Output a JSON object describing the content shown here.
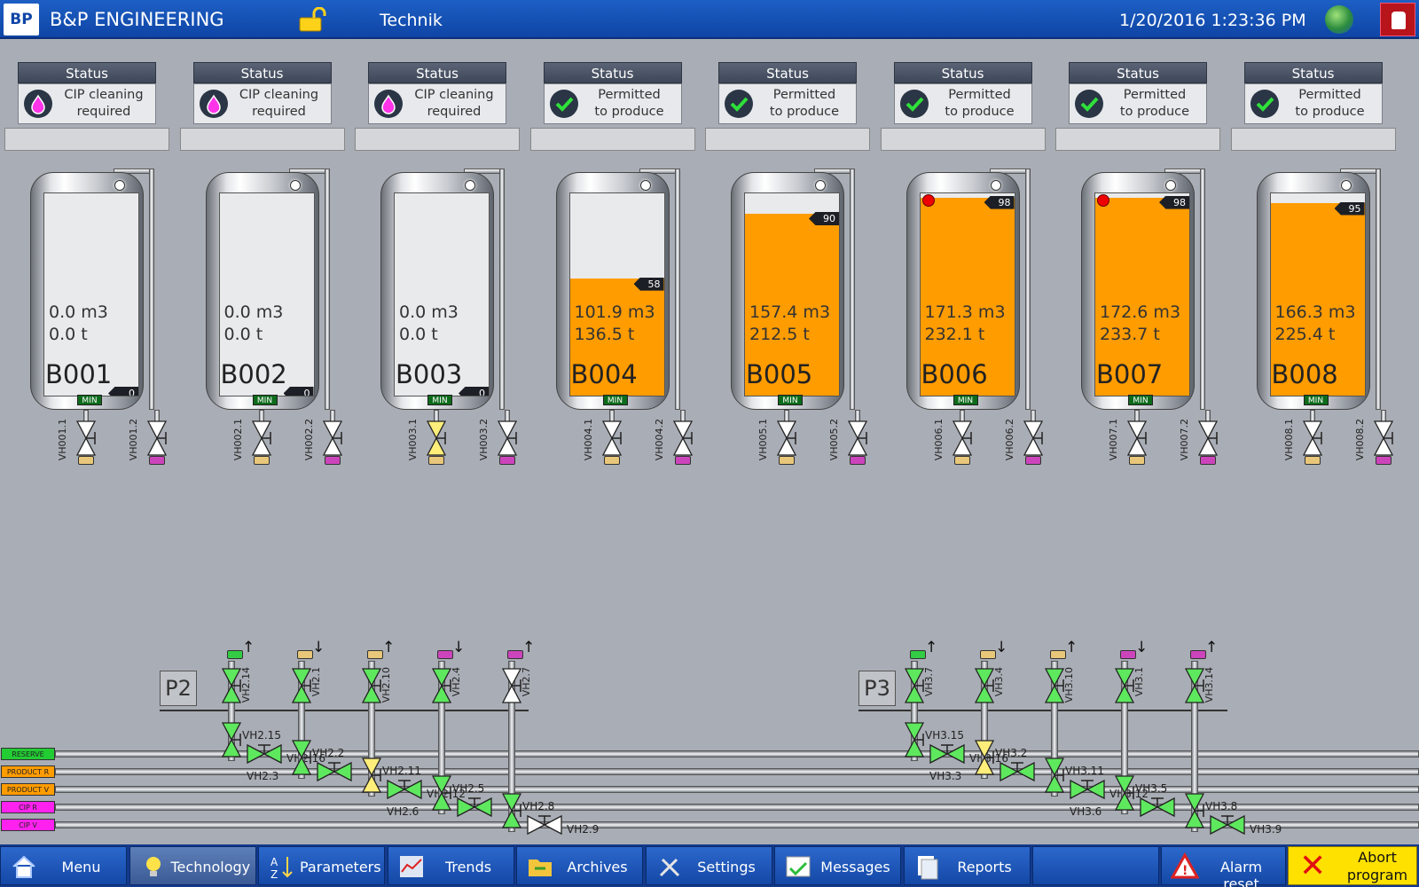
{
  "header": {
    "company": "B&P ENGINEERING",
    "logo_text": "BP",
    "screen_name": "Technik",
    "datetime": "1/20/2016 1:23:36 PM"
  },
  "tanks": [
    {
      "name": "B001",
      "status_title": "Status",
      "status_text": "CIP cleaning\nrequired",
      "status_icon": "cip-drop-icon",
      "volume": "0.0 m3",
      "mass": "0.0 t",
      "level": 0,
      "level_label": "0",
      "alarm": false,
      "valve1": "VH001.1",
      "valve2": "VH001.2"
    },
    {
      "name": "B002",
      "status_title": "Status",
      "status_text": "CIP cleaning\nrequired",
      "status_icon": "cip-drop-icon",
      "volume": "0.0 m3",
      "mass": "0.0 t",
      "level": 0,
      "level_label": "0",
      "alarm": false,
      "valve1": "VH002.1",
      "valve2": "VH002.2"
    },
    {
      "name": "B003",
      "status_title": "Status",
      "status_text": "CIP cleaning\nrequired",
      "status_icon": "cip-drop-icon",
      "volume": "0.0 m3",
      "mass": "0.0 t",
      "level": 0,
      "level_label": "0",
      "alarm": false,
      "valve1": "VH003.1",
      "valve2": "VH003.2"
    },
    {
      "name": "B004",
      "status_title": "Status",
      "status_text": "Permitted\nto produce",
      "status_icon": "check-icon",
      "volume": "101.9 m3",
      "mass": "136.5 t",
      "level": 58,
      "level_label": "58",
      "alarm": false,
      "valve1": "VH004.1",
      "valve2": "VH004.2"
    },
    {
      "name": "B005",
      "status_title": "Status",
      "status_text": "Permitted\nto produce",
      "status_icon": "check-icon",
      "volume": "157.4 m3",
      "mass": "212.5 t",
      "level": 90,
      "level_label": "90",
      "alarm": false,
      "valve1": "VH005.1",
      "valve2": "VH005.2"
    },
    {
      "name": "B006",
      "status_title": "Status",
      "status_text": "Permitted\nto produce",
      "status_icon": "check-icon",
      "volume": "171.3 m3",
      "mass": "232.1 t",
      "level": 98,
      "level_label": "98",
      "alarm": true,
      "valve1": "VH006.1",
      "valve2": "VH006.2"
    },
    {
      "name": "B007",
      "status_title": "Status",
      "status_text": "Permitted\nto produce",
      "status_icon": "check-icon",
      "volume": "172.6 m3",
      "mass": "233.7 t",
      "level": 98,
      "level_label": "98",
      "alarm": true,
      "valve1": "VH007.1",
      "valve2": "VH007.2"
    },
    {
      "name": "B008",
      "status_title": "Status",
      "status_text": "Permitted\nto produce",
      "status_icon": "check-icon",
      "volume": "166.3 m3",
      "mass": "225.4 t",
      "level": 95,
      "level_label": "95",
      "alarm": false,
      "valve1": "VH008.1",
      "valve2": "VH008.2"
    }
  ],
  "tank_min_label": "MIN",
  "lines": [
    {
      "label": "RESERVE",
      "color": "#22cc33"
    },
    {
      "label": "PRODUCT R",
      "color": "#ff9c00"
    },
    {
      "label": "PRODUCT V",
      "color": "#ff9c00"
    },
    {
      "label": "CIP R",
      "color": "#ff22ee"
    },
    {
      "label": "CIP V",
      "color": "#ff22ee"
    }
  ],
  "p2": {
    "label": "P2",
    "top_valves": [
      "VH2.14",
      "VH2.1",
      "VH2.10",
      "VH2.4",
      "VH2.7"
    ],
    "valve_labels": [
      "VH2.15",
      "VH2.16",
      "VH2.2",
      "VH2.3",
      "VH2.11",
      "VH2.12",
      "VH2.5",
      "VH2.6",
      "VH2.8",
      "VH2.9"
    ]
  },
  "p3": {
    "label": "P3",
    "top_valves": [
      "VH3.7",
      "VH3.4",
      "VH3.10",
      "VH3.1",
      "VH3.14"
    ],
    "valve_labels": [
      "VH3.15",
      "VH3.16",
      "VH3.2",
      "VH3.3",
      "VH3.11",
      "VH3.12",
      "VH3.5",
      "VH3.6",
      "VH3.8",
      "VH3.9"
    ]
  },
  "footer": {
    "buttons": [
      {
        "label": "Menu",
        "icon": "home-icon"
      },
      {
        "label": "Technology",
        "icon": "bulb-icon"
      },
      {
        "label": "Parameters",
        "icon": "sort-az-icon"
      },
      {
        "label": "Trends",
        "icon": "trend-chart-icon"
      },
      {
        "label": "Archives",
        "icon": "archive-folder-icon"
      },
      {
        "label": "Settings",
        "icon": "tools-icon"
      },
      {
        "label": "Messages",
        "icon": "messages-icon"
      },
      {
        "label": "Reports",
        "icon": "reports-icon"
      },
      {
        "label": "",
        "icon": ""
      }
    ],
    "alarm_reset": "Alarm reset",
    "abort": "Abort\nprogram"
  },
  "colors": {
    "product": "#ff9c00",
    "valve_open": "#5ee85e",
    "valve_transition": "#ffef7a",
    "valve_closed": "#ffffff"
  }
}
